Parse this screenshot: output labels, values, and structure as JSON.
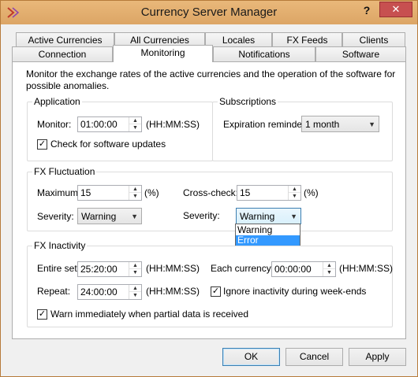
{
  "window": {
    "title": "Currency Server Manager",
    "help_label": "?",
    "close_label": "✕",
    "accent": "#dca565"
  },
  "tabs_row1": [
    {
      "label": "Active Currencies"
    },
    {
      "label": "All Currencies"
    },
    {
      "label": "Locales"
    },
    {
      "label": "FX Feeds"
    },
    {
      "label": "Clients"
    }
  ],
  "tabs_row2": [
    {
      "label": "Connection"
    },
    {
      "label": "Monitoring",
      "active": true
    },
    {
      "label": "Notifications"
    },
    {
      "label": "Software"
    }
  ],
  "description": "Monitor the exchange rates of the active currencies and the operation of the software for possible anomalies.",
  "application": {
    "title": "Application",
    "monitor_label": "Monitor:",
    "monitor_value": "01:00:00",
    "monitor_unit": "(HH:MM:SS)",
    "check_updates_label": "Check for software updates",
    "check_updates_checked": true
  },
  "subscriptions": {
    "title": "Subscriptions",
    "expiration_label": "Expiration reminder:",
    "expiration_value": "1 month"
  },
  "fx_fluctuation": {
    "title": "FX Fluctuation",
    "maximum_label": "Maximum:",
    "maximum_value": "15",
    "maximum_unit": "(%)",
    "crosscheck_label": "Cross-check:",
    "crosscheck_value": "15",
    "crosscheck_unit": "(%)",
    "severity_label": "Severity:",
    "severity_value": "Warning",
    "severity2_label": "Severity:",
    "severity2_value": "Warning",
    "severity2_options": [
      "Warning",
      "Error"
    ],
    "severity2_highlighted": "Error"
  },
  "fx_inactivity": {
    "title": "FX Inactivity",
    "entire_set_label": "Entire set:",
    "entire_set_value": "25:20:00",
    "entire_set_unit": "(HH:MM:SS)",
    "each_currency_label": "Each currency:",
    "each_currency_value": "00:00:00",
    "each_currency_unit": "(HH:MM:SS)",
    "repeat_label": "Repeat:",
    "repeat_value": "24:00:00",
    "repeat_unit": "(HH:MM:SS)",
    "ignore_weekends_label": "Ignore inactivity during week-ends",
    "ignore_weekends_checked": true,
    "warn_partial_label": "Warn immediately when partial data is received",
    "warn_partial_checked": true
  },
  "buttons": {
    "ok": "OK",
    "cancel": "Cancel",
    "apply": "Apply"
  }
}
